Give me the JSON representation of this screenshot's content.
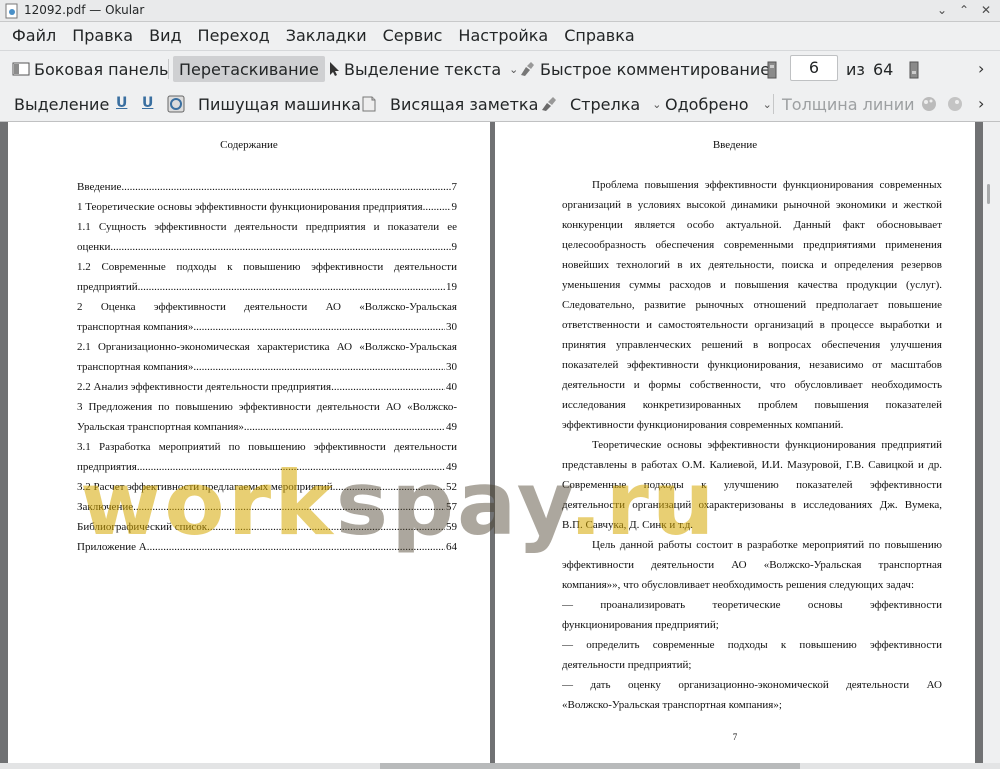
{
  "window": {
    "title": "12092.pdf — Okular"
  },
  "menubar": {
    "items": [
      "Файл",
      "Правка",
      "Вид",
      "Переход",
      "Закладки",
      "Сервис",
      "Настройка",
      "Справка"
    ]
  },
  "toolbar1": {
    "sidebar": "Боковая панель",
    "browse": "Перетаскивание",
    "text_select": "Выделение текста",
    "quick_annotations": "Быстрое комментирование",
    "page_current": "6",
    "page_of": "из",
    "page_total": "64"
  },
  "toolbar2": {
    "selection": "Выделение",
    "typewriter": "Пишущая машинка",
    "note": "Висящая заметка",
    "arrow": "Стрелка",
    "approved": "Одобрено",
    "line_width": "Толщина линии"
  },
  "left_page": {
    "heading": "Содержание",
    "toc": [
      {
        "first": "",
        "text": "Введение",
        "page": "7"
      },
      {
        "first": "",
        "text": "1 Теоретические основы эффективности функционирования предприятия",
        "page": "9"
      },
      {
        "first": "1.1 Сущность эффективности деятельности предприятия и показатели ее",
        "text": "оценки",
        "page": "9"
      },
      {
        "first": "1.2 Современные подходы к повышению эффективности деятельности",
        "text": "предприятий",
        "page": "19"
      },
      {
        "first": "2 Оценка эффективности деятельности АО «Волжско-Уральская",
        "text": "транспортная компания»",
        "page": "30"
      },
      {
        "first": "2.1 Организационно-экономическая характеристика АО «Волжско-Уральская",
        "text": "транспортная компания»",
        "page": "30"
      },
      {
        "first": "",
        "text": "2.2 Анализ эффективности деятельности предприятия",
        "page": "40"
      },
      {
        "first": "3 Предложения по повышению эффективности деятельности АО «Волжско-",
        "text": "Уральская транспортная компания»",
        "page": "49"
      },
      {
        "first": "3.1 Разработка мероприятий по повышению эффективности деятельности",
        "text": "предприятия",
        "page": "49"
      },
      {
        "first": "",
        "text": "3.2 Расчет эффективности предлагаемых мероприятий",
        "page": "52"
      },
      {
        "first": "",
        "text": "Заключение",
        "page": "57"
      },
      {
        "first": "",
        "text": "Библиографический список",
        "page": "59"
      },
      {
        "first": "",
        "text": "Приложение А",
        "page": "64"
      }
    ]
  },
  "right_page": {
    "heading": "Введение",
    "lines": [
      "Проблема повышения эффективности функционирования современных",
      "организаций в условиях высокой динамики рыночной экономики и жесткой",
      "конкуренции является особо актуальной. Данный факт обосновывает",
      "целесообразность обеспечения современными предприятиями применения",
      "новейших технологий в их деятельности, поиска и определения резервов",
      "уменьшения суммы расходов и повышения качества продукции (услуг).",
      "Следовательно, развитие рыночных отношений предполагает повышение",
      "ответственности и самостоятельности организаций в процессе выработки и",
      "принятия управленческих решений в вопросах обеспечения улучшения",
      "показателей эффективности функционирования, независимо от масштабов",
      "деятельности и формы собственности, что обусловливает необходимость",
      "исследования конкретизированных проблем повышения показателей",
      "эффективности функционирования современных компаний.",
      "Теоретические основы эффективности функционирования предприятий",
      "представлены в работах О.М. Калиевой, И.И. Мазуровой, Г.В. Савицкой и др.",
      "Современные подходы к улучшению показателей эффективности",
      "деятельности организаций охарактеризованы в исследованиях Дж. Вумека,",
      "В.П. Савчука, Д. Синк и т.д.",
      "Цель данной работы состоит в разработке мероприятий по повышению",
      "эффективности деятельности АО «Волжско-Уральская транспортная",
      "компания»», что обусловливает необходимость решения следующих задач:",
      "— проанализировать теоретические основы эффективности",
      "функционирования предприятий;",
      "— определить современные подходы к повышению эффективности",
      "деятельности предприятий;",
      "— дать оценку организационно-экономической деятельности АО",
      "«Волжско-Уральская транспортная компания»;"
    ],
    "page_number": "7"
  },
  "watermark": {
    "part1": "work",
    "part2": "spay",
    "part3": ".ru"
  }
}
